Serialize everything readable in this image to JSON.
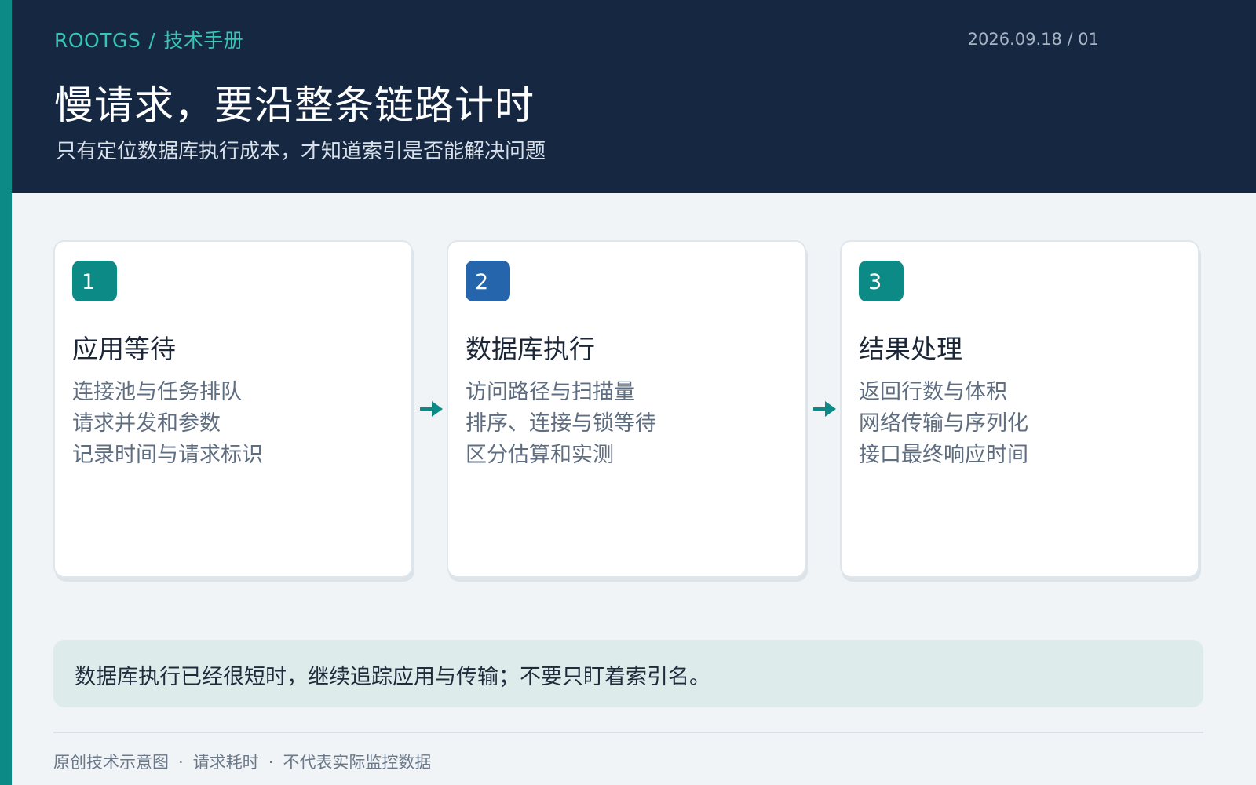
{
  "header": {
    "brand": "ROOTGS",
    "separator": "/",
    "section": "技术手册",
    "date_page": "2026.09.18 / 01",
    "title": "慢请求，要沿整条链路计时",
    "subtitle": "只有定位数据库执行成本，才知道索引是否能解决问题"
  },
  "steps": [
    {
      "number": "1",
      "title": "应用等待",
      "items": [
        "连接池与任务排队",
        "请求并发和参数",
        "记录时间与请求标识"
      ],
      "badge_color": "#0b8a86"
    },
    {
      "number": "2",
      "title": "数据库执行",
      "items": [
        "访问路径与扫描量",
        "排序、连接与锁等待",
        "区分估算和实测"
      ],
      "badge_color": "#2565ab"
    },
    {
      "number": "3",
      "title": "结果处理",
      "items": [
        "返回行数与体积",
        "网络传输与序列化",
        "接口最终响应时间"
      ],
      "badge_color": "#0b8a86"
    }
  ],
  "callout": {
    "text": "数据库执行已经很短时，继续追踪应用与传输；不要只盯着索引名。"
  },
  "footer": {
    "items": [
      "原创技术示意图",
      "请求耗时",
      "不代表实际监控数据"
    ],
    "separator": "·"
  },
  "colors": {
    "accent": "#0b8a86",
    "header_bg": "#162742",
    "blue": "#2565ab",
    "page_bg": "#f0f4f7",
    "callout_bg": "#ddebea"
  },
  "icons": {
    "step_connector": "arrow-right-icon"
  }
}
